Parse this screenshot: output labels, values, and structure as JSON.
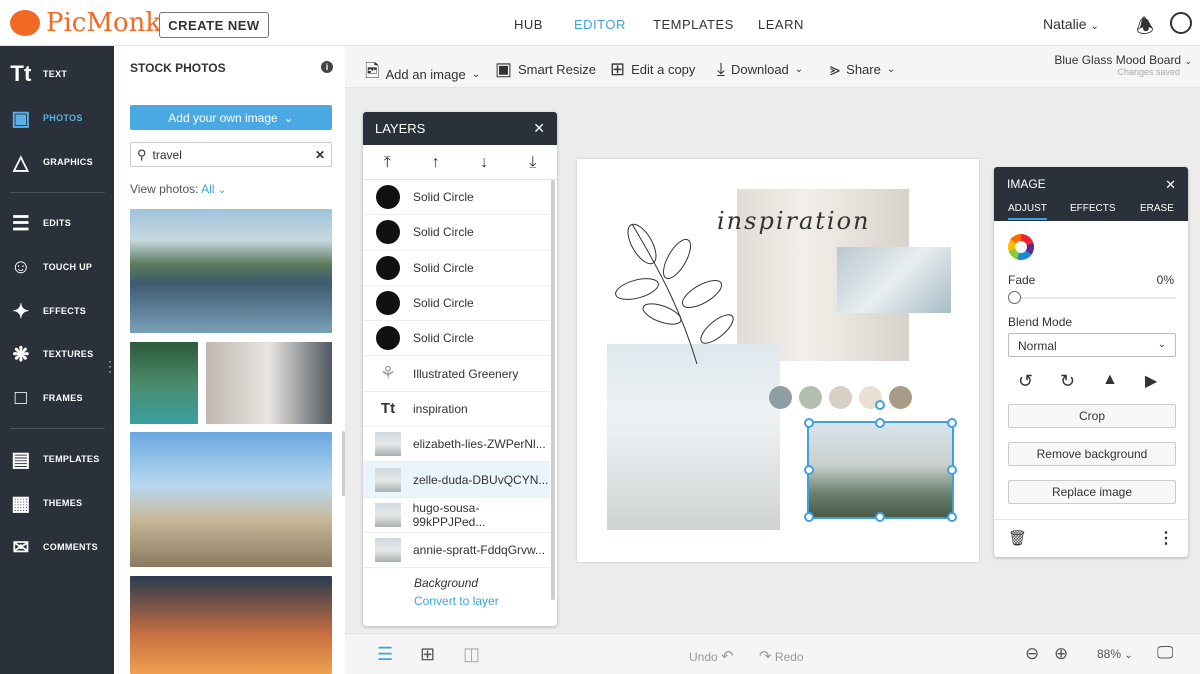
{
  "header": {
    "logo": "PicMonkey",
    "create_new": "CREATE NEW",
    "nav": [
      "HUB",
      "EDITOR",
      "TEMPLATES",
      "LEARN"
    ],
    "active_nav": "EDITOR",
    "user": "Natalie"
  },
  "sidebar": {
    "items": [
      {
        "label": "TEXT",
        "icon": "text-icon"
      },
      {
        "label": "PHOTOS",
        "icon": "photos-icon",
        "active": true
      },
      {
        "label": "GRAPHICS",
        "icon": "graphics-icon"
      },
      {
        "label": "EDITS",
        "icon": "sliders-icon"
      },
      {
        "label": "TOUCH UP",
        "icon": "face-icon"
      },
      {
        "label": "EFFECTS",
        "icon": "wand-icon"
      },
      {
        "label": "TEXTURES",
        "icon": "texture-icon"
      },
      {
        "label": "FRAMES",
        "icon": "frame-icon"
      },
      {
        "label": "TEMPLATES",
        "icon": "template-icon"
      },
      {
        "label": "THEMES",
        "icon": "themes-icon"
      },
      {
        "label": "COMMENTS",
        "icon": "comment-icon"
      }
    ]
  },
  "stock": {
    "title": "STOCK PHOTOS",
    "add_button": "Add your own image",
    "search_value": "travel",
    "view_label": "View photos:",
    "view_value": "All"
  },
  "toolbar": {
    "add_image": "Add an image",
    "smart_resize": "Smart Resize",
    "edit_copy": "Edit a copy",
    "download": "Download",
    "share": "Share",
    "doc_title": "Blue Glass Mood Board",
    "status": "Changes saved"
  },
  "layers": {
    "title": "LAYERS",
    "items": [
      {
        "name": "Solid Circle",
        "type": "circle"
      },
      {
        "name": "Solid Circle",
        "type": "circle"
      },
      {
        "name": "Solid Circle",
        "type": "circle"
      },
      {
        "name": "Solid Circle",
        "type": "circle"
      },
      {
        "name": "Solid Circle",
        "type": "circle"
      },
      {
        "name": "Illustrated Greenery",
        "type": "graphic"
      },
      {
        "name": "inspiration",
        "type": "text"
      },
      {
        "name": "elizabeth-lies-ZWPerNl...",
        "type": "image"
      },
      {
        "name": "zelle-duda-DBUvQCYN...",
        "type": "image",
        "selected": true
      },
      {
        "name": "hugo-sousa-99kPPJPed...",
        "type": "image"
      },
      {
        "name": "annie-spratt-FddqGrvw...",
        "type": "image"
      }
    ],
    "background": "Background",
    "convert": "Convert to layer"
  },
  "canvas": {
    "text": "inspiration",
    "swatches": [
      "#8e9ea2",
      "#b3bfae",
      "#d6cfc4",
      "#e9e1d5",
      "#a89c86"
    ]
  },
  "image_panel": {
    "title": "IMAGE",
    "tabs": [
      "ADJUST",
      "EFFECTS",
      "ERASE"
    ],
    "active_tab": "ADJUST",
    "fade_label": "Fade",
    "fade_value": "0%",
    "fade": 0,
    "blend_label": "Blend Mode",
    "blend_value": "Normal",
    "crop": "Crop",
    "remove_bg": "Remove background",
    "replace": "Replace image"
  },
  "bottom": {
    "undo": "Undo",
    "redo": "Redo",
    "zoom": "88%"
  },
  "colors": {
    "accent": "#3ea3dc",
    "sidebar": "#2a313b",
    "brand": "#f06a25"
  }
}
